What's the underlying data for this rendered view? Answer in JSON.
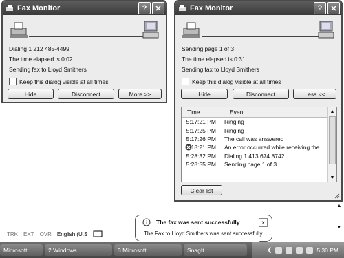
{
  "left_window": {
    "title": "Fax Monitor",
    "help_label": "?",
    "close_label": "✕",
    "status": [
      "Dialing 1 212 485-4499",
      "The time elapsed is 0:02",
      "Sending fax to Lloyd Smithers"
    ],
    "keep_visible_label": "Keep this dialog visible at all times",
    "buttons": {
      "hide": "Hide",
      "disconnect": "Disconnect",
      "more": "More >>"
    }
  },
  "right_window": {
    "title": "Fax Monitor",
    "help_label": "?",
    "close_label": "✕",
    "status": [
      "Sending page 1 of 3",
      "The time elapsed is 0:31",
      "Sending fax to Lloyd Smithers"
    ],
    "keep_visible_label": "Keep this dialog visible at all times",
    "buttons": {
      "hide": "Hide",
      "disconnect": "Disconnect",
      "less": "Less <<"
    },
    "log": {
      "columns": [
        "Time",
        "Event"
      ],
      "rows": [
        {
          "time": "5:17:21 PM",
          "event": "Ringing",
          "error": false
        },
        {
          "time": "5:17:25 PM",
          "event": "Ringing",
          "error": false
        },
        {
          "time": "5:17:26 PM",
          "event": "The call was answered",
          "error": false
        },
        {
          "time": "5:18:21 PM",
          "event": "An error occurred while receiving the",
          "error": true
        },
        {
          "time": "5:28:32 PM",
          "event": "Dialing 1 413 674 8742",
          "error": false
        },
        {
          "time": "5:28:55 PM",
          "event": "Sending page 1 of 3",
          "error": false
        }
      ]
    },
    "clear_list": "Clear list"
  },
  "langbar": {
    "items": [
      "TRK",
      "EXT",
      "OVR"
    ],
    "language": "English (U.S"
  },
  "balloon": {
    "title": "The fax was sent successfully",
    "message": "The Fax to Lloyd Smithers was sent successfully.",
    "close": "x"
  },
  "taskbar": {
    "tasks": [
      "Microsoft ...",
      "2 Windows ...",
      "3 Microsoft ...",
      "SnagIt"
    ],
    "clock": "5:30 PM"
  },
  "colors": {
    "titlebar": "#4a4a4a",
    "window_bg": "#ececec",
    "taskbar": "#555555"
  }
}
